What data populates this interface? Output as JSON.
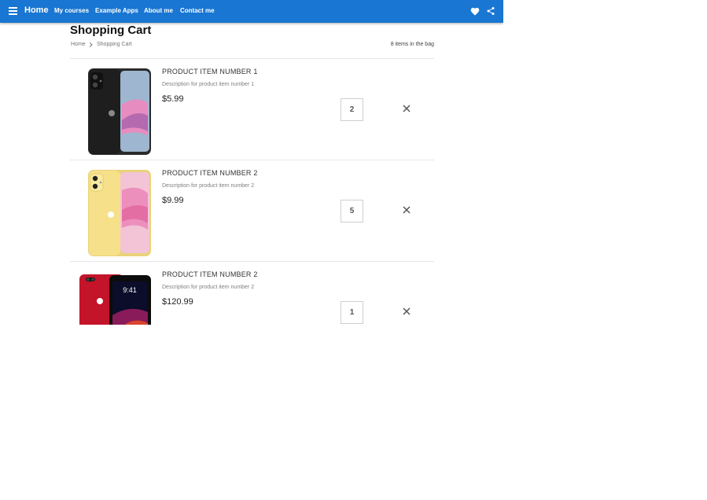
{
  "header": {
    "brand": "Home",
    "nav": [
      "My courses",
      "Example Apps",
      "About me",
      "Contact me"
    ],
    "icons": [
      "menu-icon",
      "heart-icon",
      "share-icon"
    ],
    "color": "#1976d2"
  },
  "page": {
    "title": "Shopping Cart",
    "breadcrumb": [
      "Home",
      "Shopping Cart"
    ],
    "bag_count": "8 items in the bag"
  },
  "cart": {
    "items": [
      {
        "name": "PRODUCT ITEM NUMBER 1",
        "description": "Description for product item number 1",
        "price": "$5.99",
        "quantity": "2",
        "phone_color": "#1e1e1e"
      },
      {
        "name": "PRODUCT ITEM NUMBER 2",
        "description": "Description for product item number 2",
        "price": "$9.99",
        "quantity": "5",
        "phone_color": "#f6e08a"
      },
      {
        "name": "PRODUCT ITEM NUMBER 2",
        "description": "Description for product item number 2",
        "price": "$120.99",
        "quantity": "1",
        "phone_color": "#c4142a"
      }
    ],
    "lockscreen_time": "9:41"
  }
}
